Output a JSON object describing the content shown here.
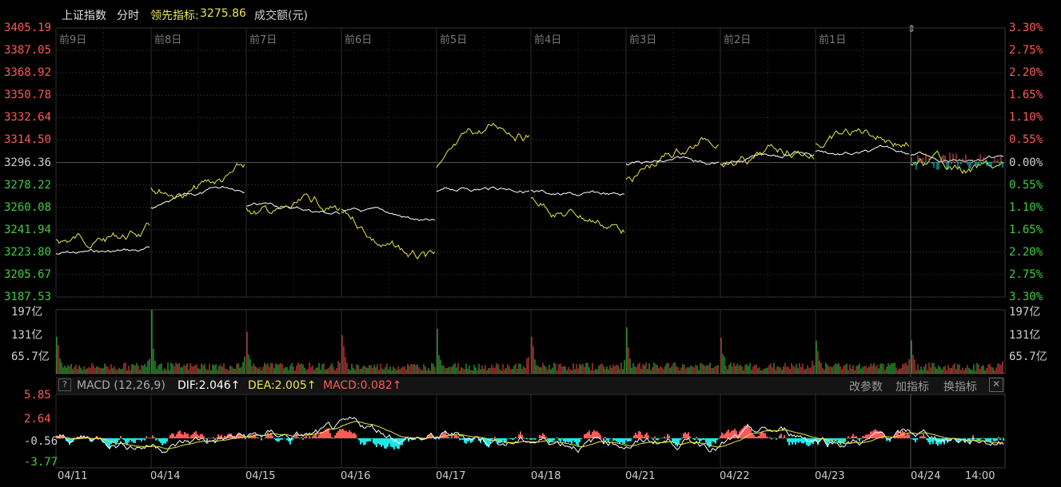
{
  "header": {
    "index_name": "上证指数",
    "mode_label": "分时",
    "lead_label": "领先指标:",
    "lead_value": "3275.86",
    "volume_label": "成交额(元)"
  },
  "price_axis": {
    "left_labels": [
      "3405.19",
      "3387.05",
      "3368.92",
      "3350.78",
      "3332.64",
      "3314.50",
      "3296.36",
      "3278.22",
      "3260.08",
      "3241.94",
      "3223.80",
      "3205.67",
      "3187.53"
    ],
    "right_labels": [
      "3.30%",
      "2.75%",
      "2.20%",
      "1.65%",
      "1.10%",
      "0.55%",
      "0.00%",
      "0.55%",
      "1.10%",
      "1.65%",
      "2.20%",
      "2.75%",
      "3.30%"
    ]
  },
  "day_labels": [
    "前9日",
    "前8日",
    "前7日",
    "前6日",
    "前5日",
    "前4日",
    "前3日",
    "前2日",
    "前1日"
  ],
  "volume_axis": {
    "left_labels": [
      "197亿",
      "131亿",
      "65.7亿"
    ],
    "right_labels": [
      "197亿",
      "131亿",
      "65.7亿"
    ]
  },
  "macd_bar": {
    "help": "?",
    "name": "MACD (12,26,9)",
    "dif": "DIF:2.046↑",
    "dea": "DEA:2.005↑",
    "macd": "MACD:0.082↑",
    "btn_change": "改参数",
    "btn_add": "加指标",
    "btn_switch": "换指标",
    "btn_close": "✕"
  },
  "macd_axis": {
    "labels": [
      "5.85",
      "2.64",
      "-0.56",
      "-3.77"
    ]
  },
  "date_labels": [
    "04/11",
    "04/14",
    "04/15",
    "04/16",
    "04/17",
    "04/18",
    "04/21",
    "04/22",
    "04/23",
    "04/24",
    "14:00"
  ],
  "colors": {
    "up": "#ff4d4d",
    "down": "#3ecf3e",
    "price_line": "#ffffff",
    "lead_line": "#e8e84a",
    "macd_neg": "#1ee6e6",
    "macd_pos": "#ff5a5a",
    "grid": "#2a2a2a"
  }
}
